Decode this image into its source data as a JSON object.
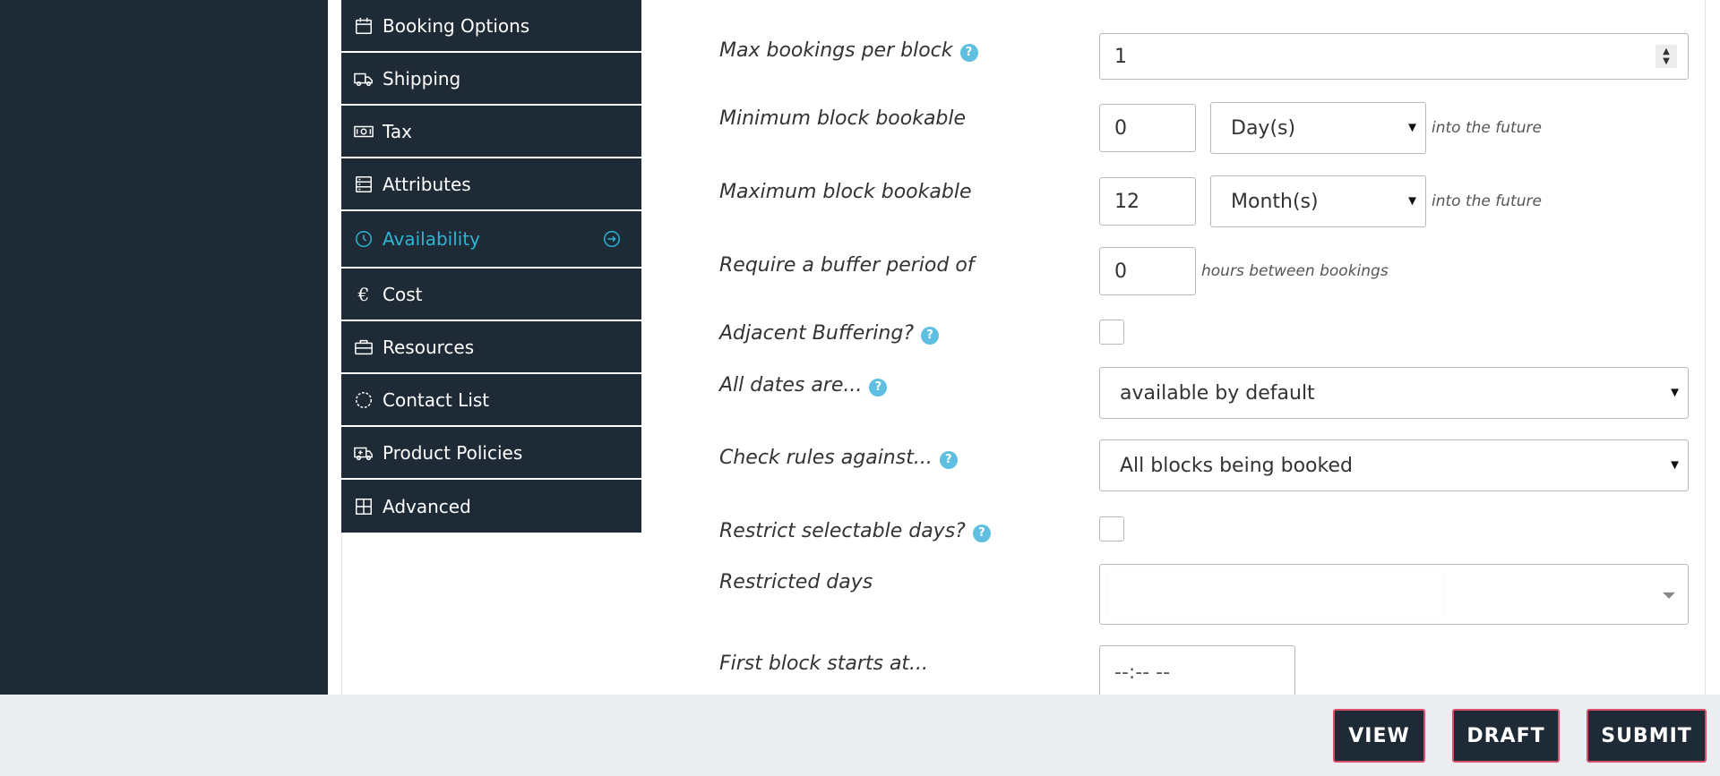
{
  "tabs": [
    {
      "label": "Booking Options",
      "icon": "calendar-icon"
    },
    {
      "label": "Shipping",
      "icon": "truck-icon"
    },
    {
      "label": "Tax",
      "icon": "money-icon"
    },
    {
      "label": "Attributes",
      "icon": "server-icon"
    },
    {
      "label": "Availability",
      "icon": "clock-icon",
      "active": true
    },
    {
      "label": "Cost",
      "icon": "euro-icon",
      "glyph": "€"
    },
    {
      "label": "Resources",
      "icon": "briefcase-icon"
    },
    {
      "label": "Contact List",
      "icon": "circle-dashed-icon"
    },
    {
      "label": "Product Policies",
      "icon": "ambulance-icon"
    },
    {
      "label": "Advanced",
      "icon": "grid-icon"
    }
  ],
  "form": {
    "max_bookings": {
      "label": "Max bookings per block",
      "value": "1"
    },
    "min_bookable": {
      "label": "Minimum block bookable",
      "value": "0",
      "unit": "Day(s)",
      "suffix": "into the future"
    },
    "max_bookable": {
      "label": "Maximum block bookable",
      "value": "12",
      "unit": "Month(s)",
      "suffix": "into the future"
    },
    "buffer": {
      "label": "Require a buffer period of",
      "value": "0",
      "suffix": "hours between bookings"
    },
    "adjacent": {
      "label": "Adjacent Buffering?",
      "checked": false
    },
    "all_dates": {
      "label": "All dates are...",
      "value": "available by default"
    },
    "check_rules": {
      "label": "Check rules against...",
      "value": "All blocks being booked"
    },
    "restrict_days": {
      "label": "Restrict selectable days?",
      "checked": false
    },
    "restricted_days": {
      "label": "Restricted days",
      "value": ""
    },
    "first_block": {
      "label": "First block starts at...",
      "value": "--:-- --"
    }
  },
  "help_glyph": "?",
  "buttons": {
    "view": "VIEW",
    "draft": "DRAFT",
    "submit": "SUBMIT"
  },
  "colors": {
    "panel": "#1e2a35",
    "accent": "#2ab6d4",
    "help": "#5fbfe0",
    "button_border": "#d94e6b",
    "footer": "#ecedf1"
  }
}
